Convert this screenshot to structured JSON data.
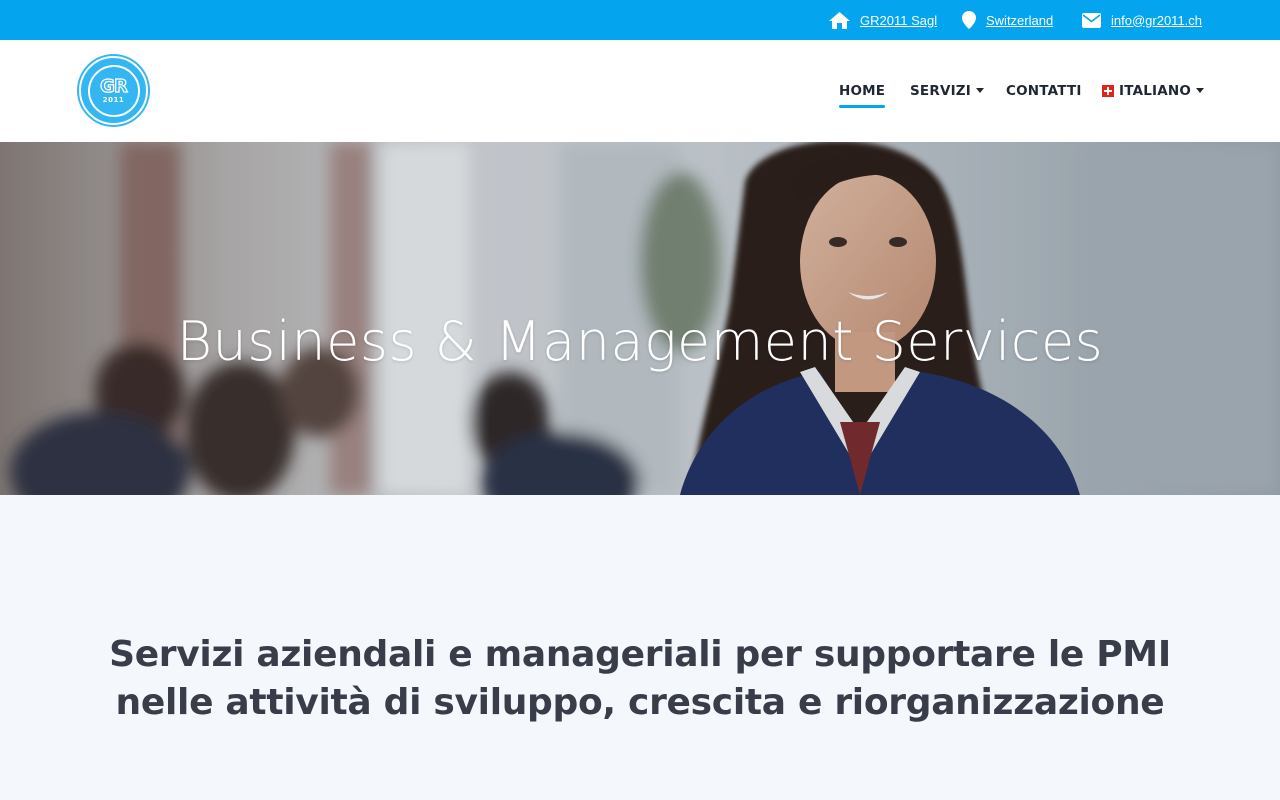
{
  "topbar": {
    "company": "GR2011 Sagl",
    "location": "Switzerland",
    "email": "info@gr2011.ch",
    "icons": [
      "home-icon",
      "map-pin-icon",
      "envelope-icon"
    ],
    "background": "#04a4ef"
  },
  "logo": {
    "letters": "GR",
    "year": "2011"
  },
  "nav": {
    "home": "HOME",
    "servizi": "SERVIZI",
    "contatti": "CONTATTI",
    "language": "ITALIANO",
    "active": "HOME",
    "accent": "#04a4ef"
  },
  "hero": {
    "title": "Business & Management Services"
  },
  "intro": {
    "text": "Servizi aziendali e manageriali per supportare le PMI nelle attività di sviluppo, crescita e riorganizzazione"
  }
}
